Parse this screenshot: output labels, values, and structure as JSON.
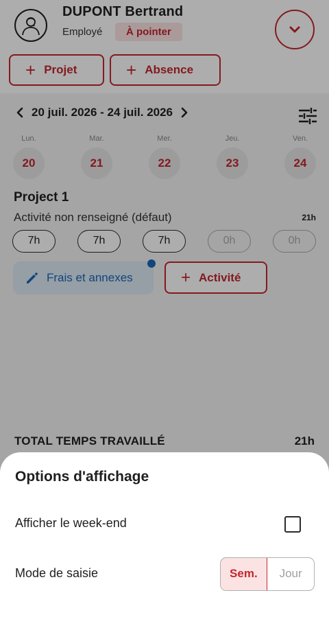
{
  "header": {
    "user_name": "DUPONT Bertrand",
    "role": "Employé",
    "status": "À pointer",
    "buttons": [
      {
        "label": "Projet"
      },
      {
        "label": "Absence"
      }
    ]
  },
  "week": {
    "range": "20 juil. 2026 - 24 juil. 2026",
    "days": [
      {
        "label": "Lun.",
        "number": "20"
      },
      {
        "label": "Mar.",
        "number": "21"
      },
      {
        "label": "Mer.",
        "number": "22"
      },
      {
        "label": "Jeu.",
        "number": "23"
      },
      {
        "label": "Ven.",
        "number": "24"
      }
    ]
  },
  "project": {
    "title": "Project 1",
    "activity": "Activité non renseigné (défaut)",
    "activity_total": "21h",
    "hours": [
      "7h",
      "7h",
      "7h",
      "0h",
      "0h"
    ]
  },
  "actions": {
    "frais_label": "Frais et annexes",
    "activite_label": "Activité"
  },
  "total": {
    "label": "TOTAL TEMPS TRAVAILLÉ",
    "value": "21h"
  },
  "sheet": {
    "title": "Options d'affichage",
    "weekend_label": "Afficher le week-end",
    "weekend_checked": false,
    "mode_label": "Mode de saisie",
    "mode_options": [
      "Sem.",
      "Jour"
    ],
    "mode_selected": "Sem."
  },
  "colors": {
    "accent": "#c4262e",
    "accent_light": "#fbe3e3",
    "info": "#1967b8",
    "info_light": "#dde9f5"
  }
}
